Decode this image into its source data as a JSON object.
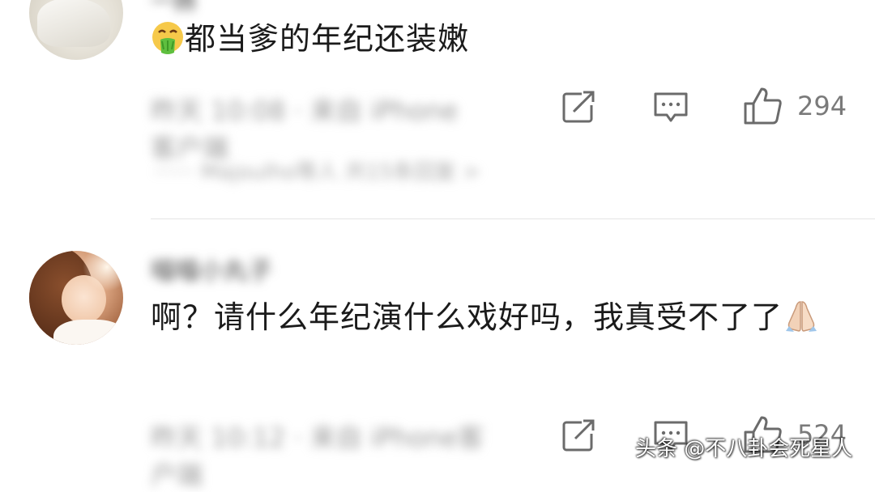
{
  "comments": [
    {
      "username": "一扬",
      "text": "都当爹的年纪还装嫩",
      "emoji": "vomiting-face-emoji",
      "meta_blurred": "昨天 10:08  ·  来自 iPhone客户端",
      "likes": "294",
      "reply_preview_blurred": "······  Majoulho等人 共15条回复 >"
    },
    {
      "username": "喵喵小丸子",
      "text": "啊？请什么年纪演什么戏好吗，我真受不了了",
      "emoji": "folded-hands-emoji",
      "meta_blurred": "昨天 10:12  ·  来自 iPhone客户端",
      "likes": "524"
    }
  ],
  "watermark": "头条 @不八卦会死星人",
  "colors": {
    "text": "#1b1b1b",
    "meta": "#9a9a9a",
    "icon": "#6b6b6b",
    "link": "#5b8fd6",
    "divider": "#e4e4e4"
  }
}
